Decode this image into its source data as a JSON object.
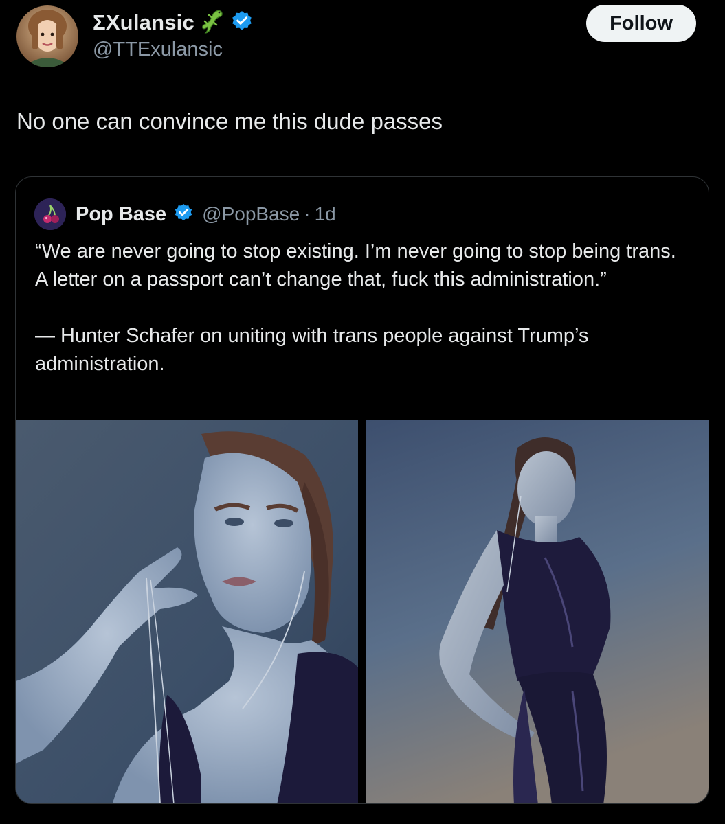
{
  "author": {
    "display_name": "ΣXulansic",
    "handle": "@TTExulansic",
    "name_emoji": "lizard-icon",
    "verified_icon": "verified-badge-icon"
  },
  "follow_button": {
    "label": "Follow"
  },
  "tweet": {
    "text": "No one can convince me this dude passes"
  },
  "quoted_tweet": {
    "display_name": "Pop Base",
    "handle": "@PopBase",
    "separator": "·",
    "time": "1d",
    "verified_icon": "verified-badge-icon",
    "quote_lines": [
      "“We are never going to stop existing. I’m never going to stop being trans. A letter on a passport can’t change that, fuck this administration.”"
    ],
    "attribution": "— Hunter Schafer on uniting with trans people against Trump’s administration.",
    "media": [
      {
        "kind": "photo",
        "icon": "photo-portrait-closeup"
      },
      {
        "kind": "photo",
        "icon": "photo-portrait-fullbody"
      }
    ]
  },
  "colors": {
    "background": "#000000",
    "text_primary": "#e7e9ea",
    "text_secondary": "#8b98a5",
    "verified_blue": "#1d9bf0",
    "follow_bg": "#eff3f4",
    "card_border": "#2f3336"
  }
}
